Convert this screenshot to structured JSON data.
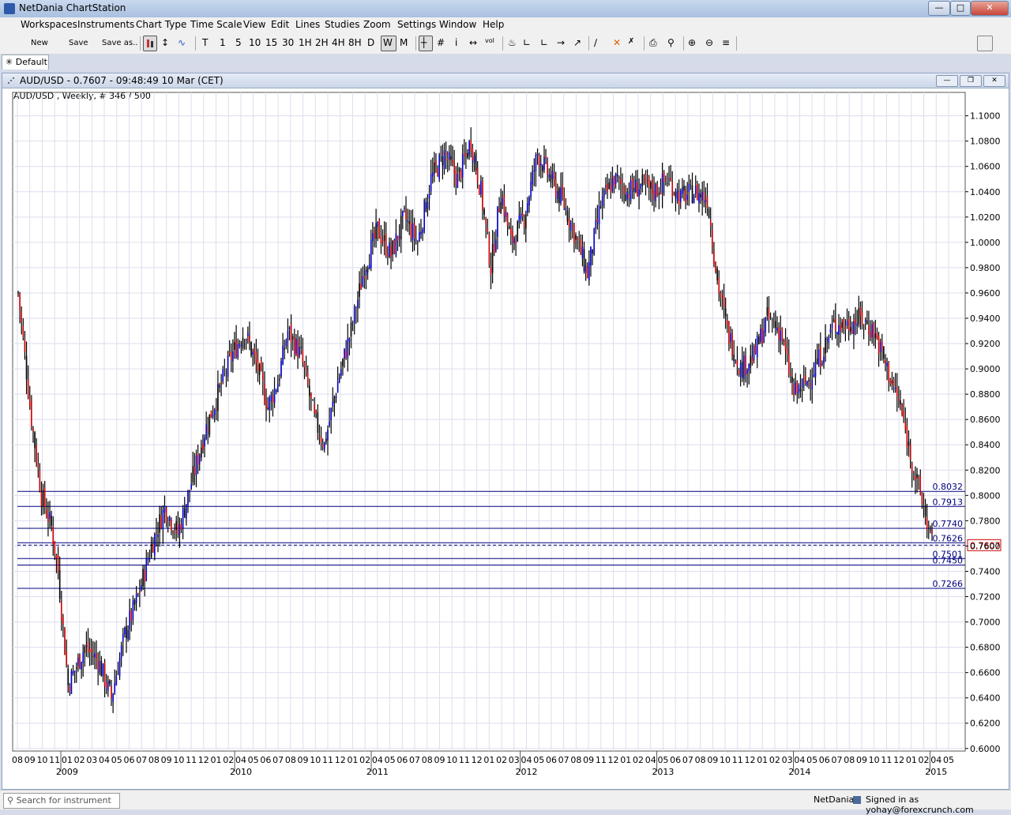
{
  "app": {
    "title": "NetDania ChartStation"
  },
  "menu": [
    "Workspaces",
    "Instruments",
    "Chart Type",
    "Time Scale",
    "View",
    "Edit",
    "Lines",
    "Studies",
    "Zoom",
    "Settings",
    "Window",
    "Help"
  ],
  "toolbar": {
    "new_label": "New",
    "save_label": "Save",
    "saveas_label": "Save as..",
    "time_buttons": [
      "T",
      "1",
      "5",
      "10",
      "15",
      "30",
      "1H",
      "2H",
      "4H",
      "8H",
      "D",
      "W",
      "M"
    ],
    "selected_time": "W"
  },
  "tabs": {
    "workspace": "Default"
  },
  "chart_window": {
    "title": "AUD/USD - 0.7607 - 09:48:49  10 Mar (CET)",
    "subtitle": "AUD/USD , Weekly, # 346 / 500"
  },
  "colors": {
    "up": "#0000cc",
    "down": "#cc0000",
    "neutral": "#000000",
    "level_line": "#00007f",
    "last_price": "#cc0000"
  },
  "chart_data": {
    "type": "bar",
    "instrument": "AUD/USD",
    "interval": "Weekly",
    "ylim": [
      0.598,
      1.111
    ],
    "yticks": [
      "1.1000",
      "1.0800",
      "1.0600",
      "1.0400",
      "1.0200",
      "1.0000",
      "0.9800",
      "0.9600",
      "0.9400",
      "0.9200",
      "0.9000",
      "0.8800",
      "0.8600",
      "0.8400",
      "0.8200",
      "0.8000",
      "0.7800",
      "0.7600",
      "0.7400",
      "0.7200",
      "0.7000",
      "0.6800",
      "0.6600",
      "0.6400",
      "0.6200",
      "0.6000"
    ],
    "level_lines": [
      "0.8032",
      "0.7913",
      "0.7740",
      "0.7626",
      "0.7501",
      "0.7450",
      "0.7266"
    ],
    "last_price": "0.7607",
    "month_ticks": [
      "08",
      "09",
      "10",
      "11",
      "01",
      "02",
      "03",
      "04",
      "05",
      "06",
      "07",
      "08",
      "09",
      "10",
      "11",
      "12",
      "01",
      "02",
      "04",
      "05",
      "06",
      "07",
      "08",
      "09",
      "10",
      "11",
      "12",
      "01",
      "02",
      "04",
      "05",
      "06",
      "07",
      "08",
      "09",
      "10",
      "11",
      "12",
      "01",
      "02",
      "03",
      "04",
      "05",
      "06",
      "07",
      "08",
      "09",
      "11",
      "12",
      "01",
      "02",
      "04",
      "05",
      "06",
      "07",
      "08",
      "09",
      "10",
      "11",
      "12",
      "01",
      "02",
      "03",
      "04",
      "05",
      "06",
      "07",
      "08",
      "09",
      "10",
      "11",
      "12",
      "01",
      "02",
      "04",
      "05"
    ],
    "year_labels": [
      "2009",
      "2010",
      "2011",
      "2012",
      "2013",
      "2014",
      "2015"
    ],
    "anchor_closes": [
      [
        0,
        0.96
      ],
      [
        8,
        0.86
      ],
      [
        14,
        0.8
      ],
      [
        20,
        0.775
      ],
      [
        24,
        0.74
      ],
      [
        30,
        0.65
      ],
      [
        40,
        0.68
      ],
      [
        48,
        0.67
      ],
      [
        56,
        0.64
      ],
      [
        64,
        0.69
      ],
      [
        72,
        0.72
      ],
      [
        80,
        0.76
      ],
      [
        88,
        0.79
      ],
      [
        96,
        0.77
      ],
      [
        104,
        0.81
      ],
      [
        112,
        0.85
      ],
      [
        120,
        0.88
      ],
      [
        128,
        0.91
      ],
      [
        136,
        0.93
      ],
      [
        144,
        0.9
      ],
      [
        150,
        0.87
      ],
      [
        156,
        0.89
      ],
      [
        162,
        0.93
      ],
      [
        170,
        0.91
      ],
      [
        178,
        0.86
      ],
      [
        184,
        0.84
      ],
      [
        192,
        0.89
      ],
      [
        200,
        0.93
      ],
      [
        208,
        0.98
      ],
      [
        216,
        1.01
      ],
      [
        224,
        0.99
      ],
      [
        232,
        1.02
      ],
      [
        240,
        1.0
      ],
      [
        248,
        1.05
      ],
      [
        256,
        1.07
      ],
      [
        264,
        1.05
      ],
      [
        272,
        1.08
      ],
      [
        278,
        1.04
      ],
      [
        284,
        0.98
      ],
      [
        290,
        1.04
      ],
      [
        296,
        1.0
      ],
      [
        304,
        1.02
      ],
      [
        312,
        1.07
      ],
      [
        320,
        1.05
      ],
      [
        328,
        1.03
      ],
      [
        336,
        1.0
      ],
      [
        342,
        0.975
      ],
      [
        350,
        1.03
      ],
      [
        358,
        1.05
      ],
      [
        366,
        1.04
      ],
      [
        374,
        1.045
      ],
      [
        382,
        1.04
      ],
      [
        390,
        1.05
      ],
      [
        398,
        1.035
      ],
      [
        406,
        1.04
      ],
      [
        414,
        1.035
      ],
      [
        420,
        0.97
      ],
      [
        426,
        0.93
      ],
      [
        434,
        0.9
      ],
      [
        442,
        0.91
      ],
      [
        450,
        0.94
      ],
      [
        458,
        0.93
      ],
      [
        466,
        0.88
      ],
      [
        474,
        0.89
      ],
      [
        482,
        0.91
      ],
      [
        490,
        0.935
      ],
      [
        498,
        0.935
      ],
      [
        506,
        0.94
      ],
      [
        514,
        0.93
      ],
      [
        522,
        0.9
      ],
      [
        530,
        0.87
      ],
      [
        538,
        0.82
      ],
      [
        544,
        0.79
      ],
      [
        549,
        0.762
      ]
    ]
  },
  "status": {
    "search_placeholder": "Search for instrument",
    "brand": "NetDania",
    "signed_in": "Signed in as yohay@forexcrunch.com"
  }
}
